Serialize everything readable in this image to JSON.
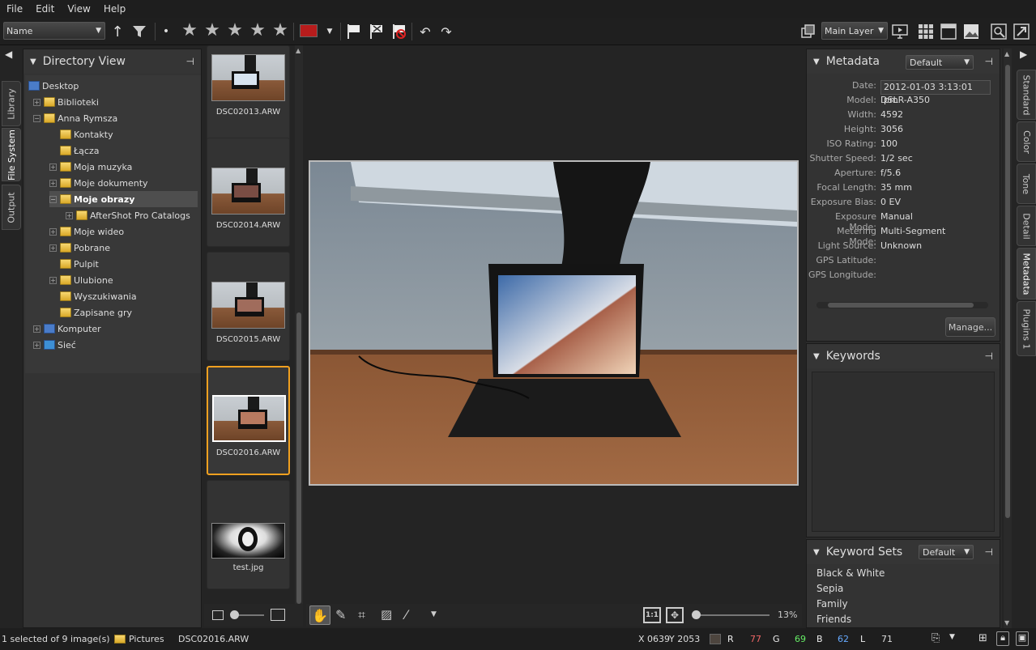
{
  "menu": [
    "File",
    "Edit",
    "View",
    "Help"
  ],
  "toolbar": {
    "sort_label": "Name",
    "layer_label": "Main Layer",
    "color_label": "#b71c1c"
  },
  "left_tabs": [
    "Library",
    "File System",
    "Output"
  ],
  "right_tabs": [
    "Standard",
    "Color",
    "Tone",
    "Detail",
    "Metadata",
    "Plugins 1"
  ],
  "directory": {
    "title": "Directory View",
    "items": [
      "Desktop",
      "Biblioteki",
      "Anna Rymsza",
      "Kontakty",
      "Łącza",
      "Moja muzyka",
      "Moje dokumenty",
      "Moje obrazy",
      "AfterShot Pro Catalogs",
      "Moje wideo",
      "Pobrane",
      "Pulpit",
      "Ulubione",
      "Wyszukiwania",
      "Zapisane gry",
      "Komputer",
      "Sieć"
    ]
  },
  "thumbnails": [
    "DSC02013.ARW",
    "DSC02014.ARW",
    "DSC02015.ARW",
    "DSC02016.ARW",
    "test.jpg"
  ],
  "metadata": {
    "title": "Metadata",
    "preset": "Default",
    "rows": [
      [
        "Date:",
        "2012-01-03 3:13:01 pm"
      ],
      [
        "Model:",
        "DSLR-A350"
      ],
      [
        "Width:",
        "4592"
      ],
      [
        "Height:",
        "3056"
      ],
      [
        "ISO Rating:",
        "100"
      ],
      [
        "Shutter Speed:",
        "1/2 sec"
      ],
      [
        "Aperture:",
        "f/5.6"
      ],
      [
        "Focal Length:",
        "35 mm"
      ],
      [
        "Exposure Bias:",
        "0 EV"
      ],
      [
        "Exposure Mode:",
        "Manual"
      ],
      [
        "Metering Mode:",
        "Multi-Segment"
      ],
      [
        "Light Source:",
        "Unknown"
      ],
      [
        "GPS Latitude:",
        ""
      ],
      [
        "GPS Longitude:",
        ""
      ]
    ],
    "manage": "Manage..."
  },
  "keywords": {
    "title": "Keywords"
  },
  "keyword_sets": {
    "title": "Keyword Sets",
    "preset": "Default",
    "items": [
      "Black & White",
      "Sepia",
      "Family",
      "Friends"
    ]
  },
  "viewer": {
    "zoom_label": "13%",
    "one_to_one": "1:1"
  },
  "status": {
    "selection": "1 selected of 9 image(s)",
    "folder": "Pictures",
    "file": "DSC02016.ARW",
    "x": "X 0639",
    "y": "Y 2053",
    "r_label": "R",
    "r": "77",
    "g_label": "G",
    "g": "69",
    "b_label": "B",
    "b": "62",
    "l_label": "L",
    "l": "71"
  }
}
